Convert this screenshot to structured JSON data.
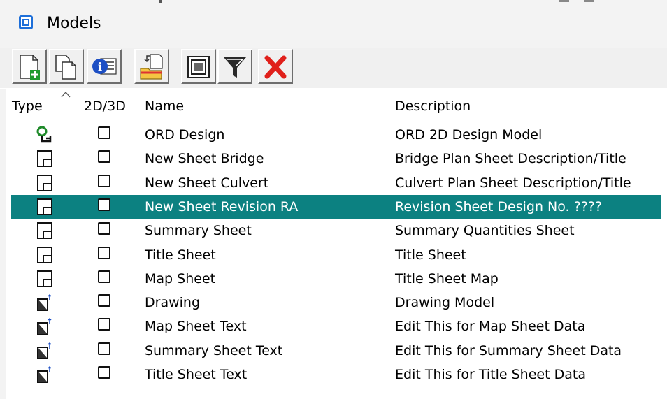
{
  "window": {
    "title": "Models",
    "app_icon": "models-cube-icon"
  },
  "toolbar": {
    "buttons": [
      {
        "name": "new-model",
        "icon": "new-model-icon"
      },
      {
        "name": "copy-model",
        "icon": "copy-model-icon"
      },
      {
        "name": "model-properties",
        "icon": "properties-icon"
      },
      {
        "name": "import-model",
        "icon": "import-folder-icon"
      },
      {
        "name": "fit-view",
        "icon": "frame-icon"
      },
      {
        "name": "filter",
        "icon": "filter-funnel-icon"
      },
      {
        "name": "delete-model",
        "icon": "delete-x-icon"
      }
    ]
  },
  "table": {
    "columns": [
      "Type",
      "2D/3D",
      "Name",
      "Description"
    ],
    "sort_indicator": "^",
    "rows": [
      {
        "type": "design-model",
        "name": "ORD Design",
        "description": "ORD 2D Design Model",
        "selected": false
      },
      {
        "type": "sheet",
        "name": "New Sheet Bridge",
        "description": "Bridge Plan Sheet Description/Title",
        "selected": false
      },
      {
        "type": "sheet",
        "name": "New Sheet Culvert",
        "description": "Culvert Plan Sheet Description/Title",
        "selected": false
      },
      {
        "type": "sheet",
        "name": "New Sheet Revision RA",
        "description": "Revision Sheet Design No. ????",
        "selected": true
      },
      {
        "type": "sheet",
        "name": "Summary Sheet",
        "description": "Summary Quantities Sheet",
        "selected": false
      },
      {
        "type": "sheet",
        "name": "Title Sheet",
        "description": "Title Sheet",
        "selected": false
      },
      {
        "type": "sheet",
        "name": "Map Sheet",
        "description": "Title Sheet Map",
        "selected": false
      },
      {
        "type": "drawing",
        "name": "Drawing",
        "description": "Drawing Model",
        "selected": false
      },
      {
        "type": "drawing",
        "name": "Map Sheet Text",
        "description": "Edit This for Map Sheet Data",
        "selected": false
      },
      {
        "type": "drawing",
        "name": "Summary Sheet Text",
        "description": "Edit This for Summary Sheet Data",
        "selected": false
      },
      {
        "type": "drawing",
        "name": "Title Sheet Text",
        "description": "Edit This for Title Sheet Data",
        "selected": false
      }
    ]
  },
  "colors": {
    "selection": "#0c8181",
    "delete_red": "#e0201b",
    "app_icon_blue": "#1e6fd9"
  }
}
